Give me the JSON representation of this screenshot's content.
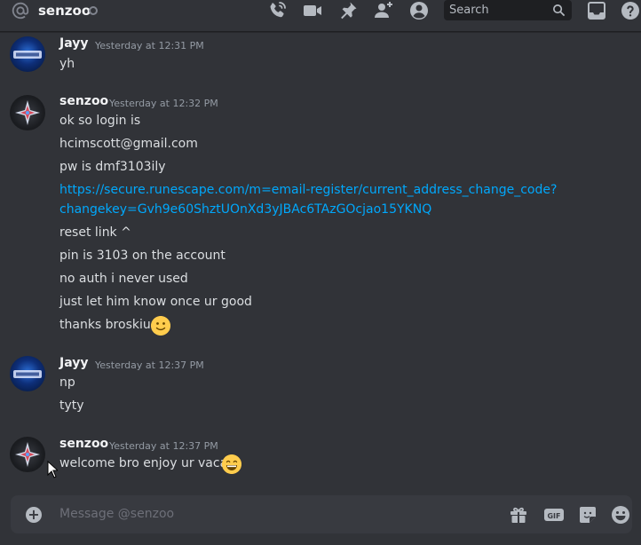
{
  "header": {
    "dm_name": "senzoo",
    "search_placeholder": "Search"
  },
  "composer": {
    "placeholder": "Message @senzoo"
  },
  "messages": [
    {
      "author": "Jayy",
      "timestamp": "Yesterday at 12:31 PM",
      "lines": [
        "yh"
      ]
    },
    {
      "author": "senzoo",
      "timestamp": "Yesterday at 12:32 PM",
      "lines": [
        "ok so login is",
        "hcimscott@gmail.com",
        "pw is dmf3103ily",
        "https://secure.runescape.com/m=email-register/current_address_change_code?",
        "changekey=Gvh9e60ShztUOnXd3yJBAc6TAzGOcjao15YKNQ",
        "reset link ^",
        "pin is 3103 on the account",
        "no auth i never used",
        "just let him know once ur good",
        "thanks broskiu"
      ]
    },
    {
      "author": "Jayy",
      "timestamp": "Yesterday at 12:37 PM",
      "lines": [
        "np",
        "tyty"
      ]
    },
    {
      "author": "senzoo",
      "timestamp": "Yesterday at 12:37 PM",
      "lines": [
        "welcome bro enjoy ur vaca"
      ]
    }
  ],
  "icons": {
    "header": [
      "at-icon",
      "status-offline-icon",
      "voice-call-icon",
      "video-call-icon",
      "pinned-messages-icon",
      "add-friends-to-dm-icon",
      "user-profile-icon",
      "search-icon",
      "inbox-icon",
      "help-icon"
    ],
    "composer": [
      "add-attachment-icon",
      "gift-icon",
      "gif-icon",
      "sticker-icon",
      "emoji-icon"
    ]
  },
  "colors": {
    "background": "#313338",
    "link": "#00a8fc",
    "username": "#f2f3f5",
    "timestamp": "#949ba4"
  }
}
